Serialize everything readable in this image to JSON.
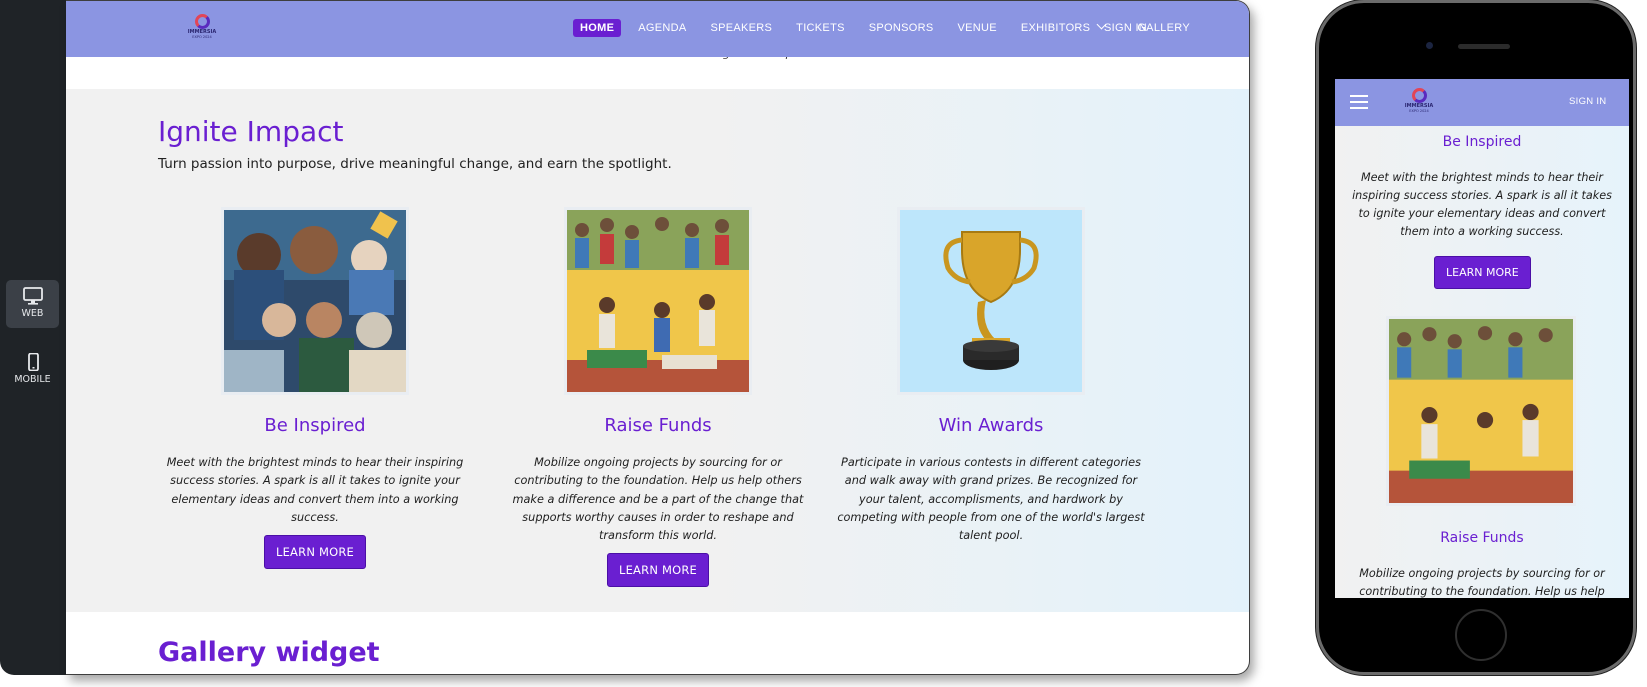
{
  "rail": {
    "items": [
      {
        "label": "WEB",
        "icon": "monitor-icon",
        "active": true
      },
      {
        "label": "MOBILE",
        "icon": "phone-icon",
        "active": false
      }
    ]
  },
  "brand": {
    "name": "IMMERSIA",
    "tagline": "EXPO 2024"
  },
  "nav": {
    "items": [
      "HOME",
      "AGENDA",
      "SPEAKERS",
      "TICKETS",
      "SPONSORS",
      "VENUE",
      "EXHIBITORS",
      "GALLERY"
    ],
    "active": "HOME",
    "dropdown_item": "EXHIBITORS",
    "sign_in": "SIGN IN"
  },
  "peek_text": "world's largest talent pool.",
  "section": {
    "title": "Ignite Impact",
    "subtitle": "Turn passion into purpose, drive meaningful change, and earn the spotlight.",
    "cards": [
      {
        "title": "Be Inspired",
        "image": "inspired-people-artwork",
        "description": "Meet with the brightest minds to hear their inspiring success stories. A spark is all it takes to ignite your elementary ideas and convert them into a working success.",
        "button": "LEARN MORE"
      },
      {
        "title": "Raise Funds",
        "image": "crowd-fundraiser-artwork",
        "description": "Mobilize ongoing projects by sourcing for or contributing to the foundation. Help us help others make a difference and be a part of the change that supports worthy causes in order to reshape and transform this world.",
        "button": "LEARN MORE"
      },
      {
        "title": "Win Awards",
        "image": "trophy-icon",
        "description": "Participate in various contests in different categories and walk away with grand prizes. Be recognized for your talent, accomplisments, and hardwork by competing with people from one of the world's largest talent pool.",
        "button": null
      }
    ]
  },
  "gallery": {
    "title": "Gallery widget"
  },
  "mobile": {
    "sign_in": "SIGN IN",
    "card1_title": "Be Inspired",
    "card1_desc": "Meet with the brightest minds to hear their inspiring success stories. A spark is all it takes to ignite your elementary ideas and convert them into a working success.",
    "card1_button": "LEARN MORE",
    "card2_title": "Raise Funds",
    "card2_desc": "Mobilize ongoing projects by sourcing for or contributing to the foundation. Help us help others"
  },
  "colors": {
    "accent": "#6a1fd1",
    "nav": "#8b95e2",
    "rail": "#1f2327"
  }
}
